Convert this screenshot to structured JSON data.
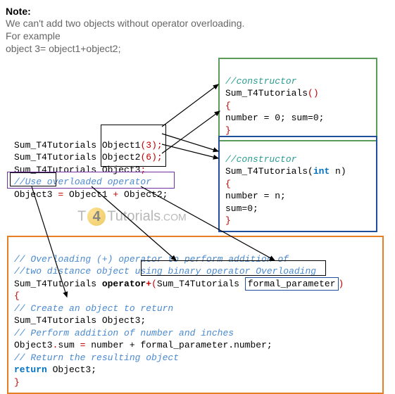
{
  "note": {
    "label": "Note:",
    "line1": "We can't add two objects without operator overloading.",
    "line2": "For example",
    "line3": "object 3= object1+object2;"
  },
  "constructor1": {
    "comment": "//constructor",
    "name": "Sum_T4Tutorials",
    "paren_open": "(",
    "paren_close": ")",
    "brace_open": "{",
    "body": "number = 0; sum=0;",
    "brace_close": "}"
  },
  "constructor2": {
    "comment": "//constructor",
    "name": "Sum_T4Tutorials",
    "paren_open": "(",
    "param_type": "int",
    "param_name": " n",
    "paren_close": ")",
    "brace_open": "{",
    "body1": "number = n;",
    "body2": "sum=0;",
    "brace_close": "}"
  },
  "decl_block": {
    "line1_type": "Sum_T4Tutorials ",
    "line1_obj": "Object1",
    "line1_arg": "3",
    "line2_type": "Sum_T4Tutorials ",
    "line2_obj": "Object2",
    "line2_arg": "6",
    "line3_type": "Sum_T4Tutorials ",
    "line3_obj": "Object3",
    "comment": "//Use overloaded operator",
    "assign_lhs": "Object3",
    "assign_eq": " = ",
    "assign_r1": "Object1",
    "assign_plus": " + ",
    "assign_r2": "Object2",
    "semi": ";"
  },
  "op_block": {
    "c1": "// Overloading (+) operator to perform addition of",
    "c2": "//two distance object using binary operator Overloading",
    "ret": "Sum_T4Tutorials ",
    "opkw": "operator",
    "plus": "+",
    "paren_open": "(",
    "ptype": "Sum_T4Tutorials ",
    "pname": "formal_parameter",
    "paren_close": ")",
    "brace_open": "{",
    "c3": "// Create an object to return",
    "decl": "Sum_T4Tutorials Object3;",
    "c4": "// Perform addition of number and inches",
    "stmt_l": "Object3",
    "stmt_dot": ".",
    "stmt_sum": "sum",
    "stmt_eq": " = ",
    "stmt_rhs": "number + formal_parameter.number;",
    "c5": "// Return the resulting object",
    "ret_kw": "return",
    "ret_obj": " Object3;",
    "brace_close": "}"
  },
  "watermark": {
    "t": "T",
    "four": "4",
    "rest": "Tutorials",
    "com": ".COM"
  }
}
